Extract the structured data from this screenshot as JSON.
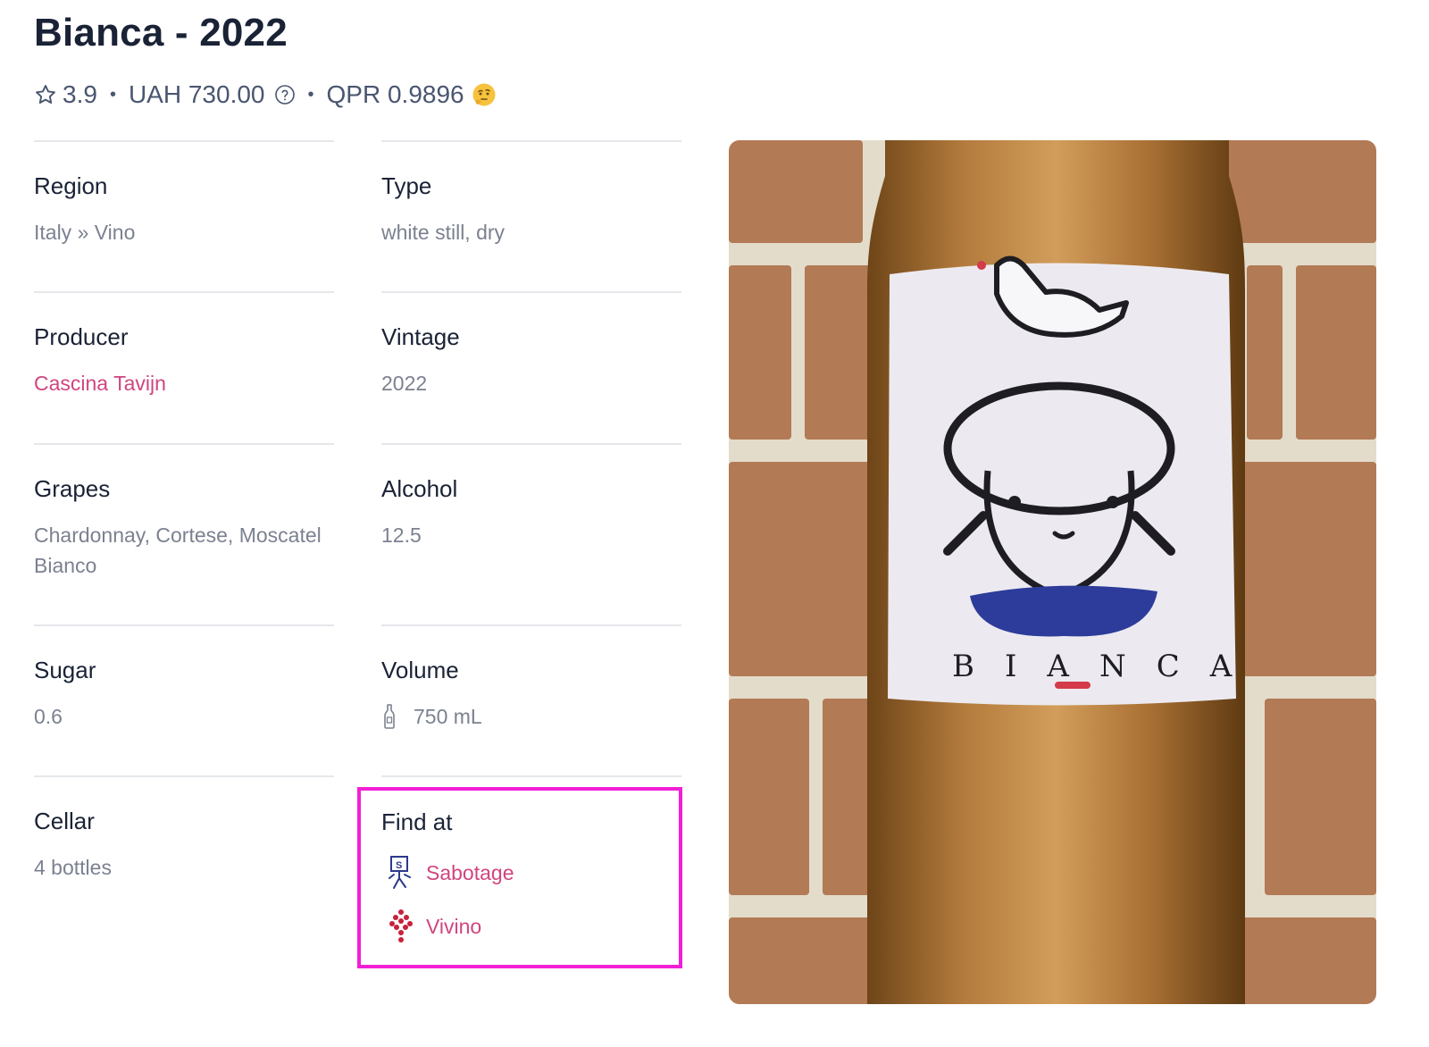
{
  "wine": {
    "title": "Bianca - 2022",
    "rating": "3.9",
    "price": "UAH 730.00",
    "qpr": "QPR 0.9896",
    "separator": "•"
  },
  "details": {
    "region": {
      "label": "Region",
      "value": "Italy » Vino"
    },
    "type": {
      "label": "Type",
      "value": "white still, dry"
    },
    "producer": {
      "label": "Producer",
      "value": "Cascina Tavijn"
    },
    "vintage": {
      "label": "Vintage",
      "value": "2022"
    },
    "grapes": {
      "label": "Grapes",
      "value": "Chardonnay, Cortese, Moscatel Bianco"
    },
    "alcohol": {
      "label": "Alcohol",
      "value": "12.5"
    },
    "sugar": {
      "label": "Sugar",
      "value": "0.6"
    },
    "volume": {
      "label": "Volume",
      "value": "750 mL"
    },
    "cellar": {
      "label": "Cellar",
      "value": "4 bottles"
    },
    "find_at": {
      "label": "Find at",
      "stores": [
        {
          "name": "Sabotage",
          "icon": "sabotage-logo-icon"
        },
        {
          "name": "Vivino",
          "icon": "vivino-grape-icon"
        }
      ]
    }
  },
  "photo": {
    "label_text": "BIANCA"
  },
  "colors": {
    "link": "#d0457f",
    "highlight_border": "#f21fd6",
    "title": "#1a2236",
    "muted": "#7b8190"
  }
}
